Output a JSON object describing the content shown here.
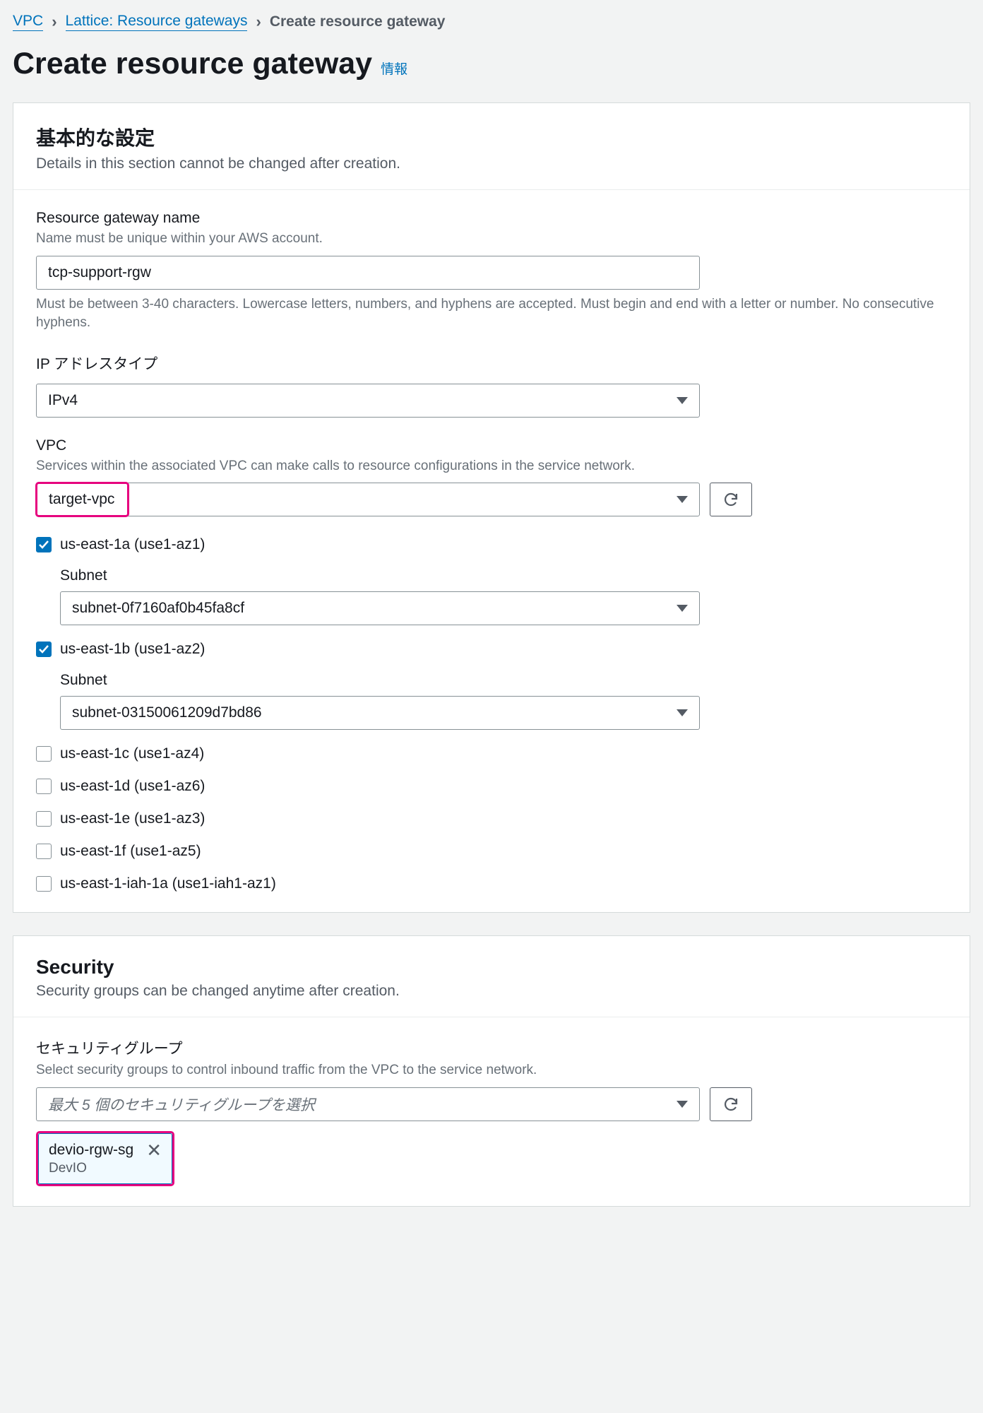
{
  "breadcrumb": {
    "items": [
      {
        "label": "VPC",
        "link": true
      },
      {
        "label": "Lattice: Resource gateways",
        "link": true
      },
      {
        "label": "Create resource gateway",
        "link": false
      }
    ]
  },
  "page": {
    "title": "Create resource gateway",
    "info_label": "情報"
  },
  "basic": {
    "heading": "基本的な設定",
    "desc": "Details in this section cannot be changed after creation.",
    "name": {
      "label": "Resource gateway name",
      "hint": "Name must be unique within your AWS account.",
      "value": "tcp-support-rgw",
      "constraint": "Must be between 3-40 characters. Lowercase letters, numbers, and hyphens are accepted. Must begin and end with a letter or number. No consecutive hyphens."
    },
    "ip": {
      "label": "IP アドレスタイプ",
      "value": "IPv4"
    },
    "vpc": {
      "label": "VPC",
      "hint": "Services within the associated VPC can make calls to resource configurations in the service network.",
      "value": "target-vpc"
    },
    "azs": [
      {
        "label": "us-east-1a (use1-az1)",
        "checked": true,
        "subnet_label": "Subnet",
        "subnet_value": "subnet-0f7160af0b45fa8cf"
      },
      {
        "label": "us-east-1b (use1-az2)",
        "checked": true,
        "subnet_label": "Subnet",
        "subnet_value": "subnet-03150061209d7bd86"
      },
      {
        "label": "us-east-1c (use1-az4)",
        "checked": false
      },
      {
        "label": "us-east-1d (use1-az6)",
        "checked": false
      },
      {
        "label": "us-east-1e (use1-az3)",
        "checked": false
      },
      {
        "label": "us-east-1f (use1-az5)",
        "checked": false
      },
      {
        "label": "us-east-1-iah-1a (use1-iah1-az1)",
        "checked": false
      }
    ]
  },
  "security": {
    "heading": "Security",
    "desc": "Security groups can be changed anytime after creation.",
    "sg": {
      "label": "セキュリティグループ",
      "hint": "Select security groups to control inbound traffic from the VPC to the service network.",
      "placeholder": "最大 5 個のセキュリティグループを選択",
      "token": {
        "name": "devio-rgw-sg",
        "sub": "DevIO"
      }
    }
  }
}
